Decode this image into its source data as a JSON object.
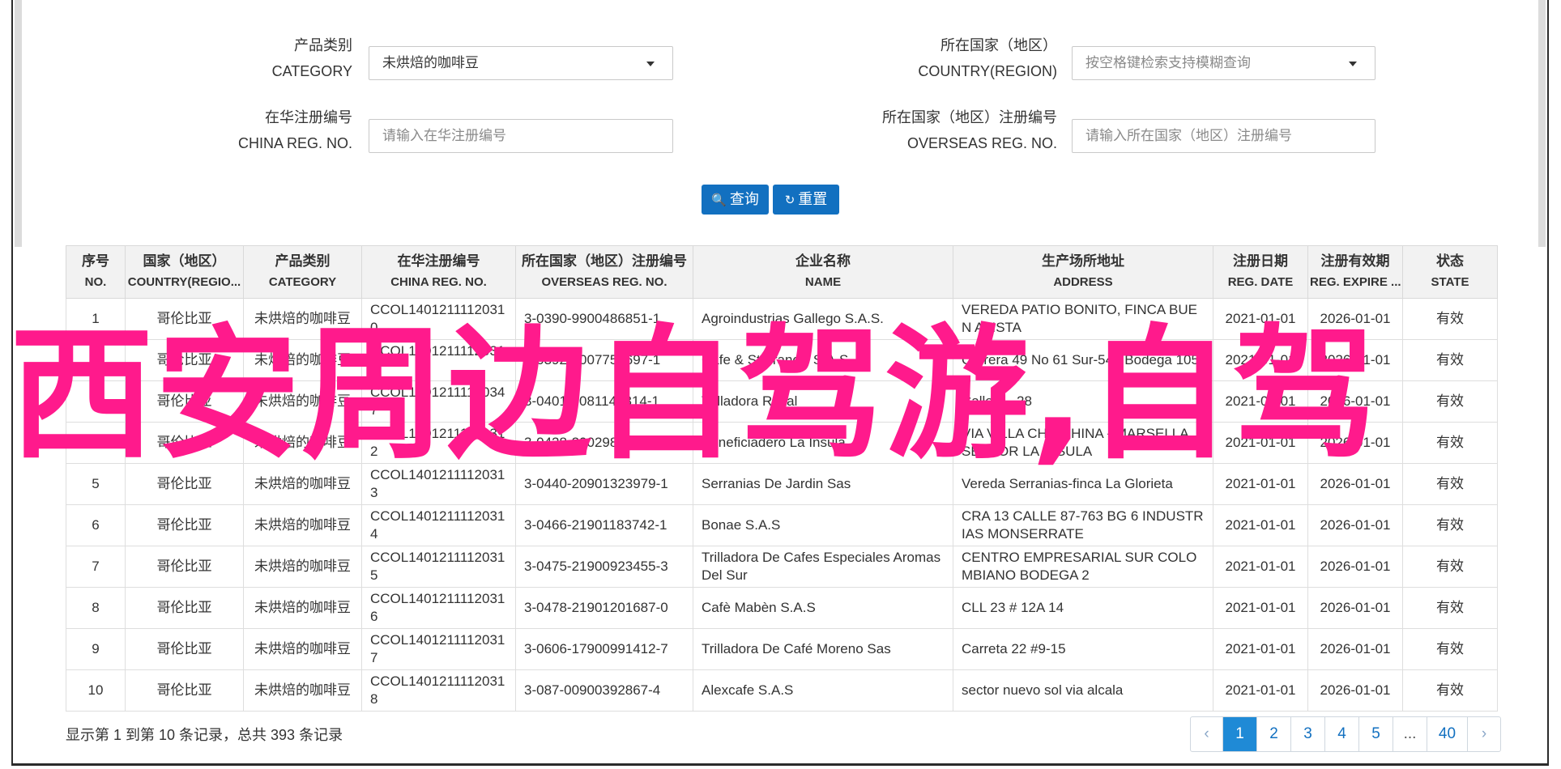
{
  "filters": {
    "category": {
      "label_cn": "产品类别",
      "label_en": "CATEGORY",
      "value": "未烘焙的咖啡豆"
    },
    "country": {
      "label_cn": "所在国家（地区）",
      "label_en": "COUNTRY(REGION)",
      "placeholder": "按空格键检索支持模糊查询"
    },
    "china_reg": {
      "label_cn": "在华注册编号",
      "label_en": "CHINA REG. NO.",
      "placeholder": "请输入在华注册编号"
    },
    "overseas_reg": {
      "label_cn": "所在国家（地区）注册编号",
      "label_en": "OVERSEAS REG. NO.",
      "placeholder": "请输入所在国家（地区）注册编号"
    }
  },
  "buttons": {
    "search": "查询",
    "reset": "重置"
  },
  "table": {
    "headers": [
      {
        "cn": "序号",
        "en": "NO."
      },
      {
        "cn": "国家（地区）",
        "en": "COUNTRY(REGIO..."
      },
      {
        "cn": "产品类别",
        "en": "CATEGORY"
      },
      {
        "cn": "在华注册编号",
        "en": "CHINA REG. NO."
      },
      {
        "cn": "所在国家（地区）注册编号",
        "en": "OVERSEAS REG. NO."
      },
      {
        "cn": "企业名称",
        "en": "NAME"
      },
      {
        "cn": "生产场所地址",
        "en": "ADDRESS"
      },
      {
        "cn": "注册日期",
        "en": "REG. DATE"
      },
      {
        "cn": "注册有效期",
        "en": "REG. EXPIRE ..."
      },
      {
        "cn": "状态",
        "en": "STATE"
      }
    ],
    "rows": [
      [
        "1",
        "哥伦比亚",
        "未烘焙的咖啡豆",
        "CCOL14012111120310",
        "3-0390-9900486851-1",
        "Agroindustrias Gallego S.A.S.",
        "VEREDA PATIO BONITO, FINCA BUEN AVISTA",
        "2021-01-01",
        "2026-01-01",
        "有效"
      ],
      [
        "2",
        "哥伦比亚",
        "未烘焙的咖啡豆",
        "CCOL14012111120311",
        "3-0392-9007758697-1",
        "Cafe & St Francis S.A.S.",
        "Carrera 49 No 61 Sur-540 Bodega 105",
        "2021-01-01",
        "2026-01-01",
        "有效"
      ],
      [
        "3",
        "哥伦比亚",
        "未烘焙的咖啡豆",
        "CCOL14012111120347",
        "3-0401-0081148314-1",
        "Trilladora Royal",
        "Calle 5 - 28",
        "2021-01-01",
        "2026-01-01",
        "有效"
      ],
      [
        "4",
        "哥伦比亚",
        "未烘焙的咖啡豆",
        "CCOL14012111120312",
        "3-0428-2002988649",
        "Beneficiadero La Insula",
        "VIA VILLA CHINCHINA - MARSELLA, SECTOR LA INSULA",
        "2021-01-01",
        "2026-01-01",
        "有效"
      ],
      [
        "5",
        "哥伦比亚",
        "未烘焙的咖啡豆",
        "CCOL14012111120313",
        "3-0440-20901323979-1",
        "Serranias De Jardin Sas",
        "Vereda Serranias-finca La Glorieta",
        "2021-01-01",
        "2026-01-01",
        "有效"
      ],
      [
        "6",
        "哥伦比亚",
        "未烘焙的咖啡豆",
        "CCOL14012111120314",
        "3-0466-21901183742-1",
        "Bonae S.A.S",
        "CRA 13 CALLE 87-763 BG 6 INDUSTRIAS MONSERRATE",
        "2021-01-01",
        "2026-01-01",
        "有效"
      ],
      [
        "7",
        "哥伦比亚",
        "未烘焙的咖啡豆",
        "CCOL14012111120315",
        "3-0475-21900923455-3",
        "Trilladora De Cafes Especiales Aromas Del Sur",
        "CENTRO EMPRESARIAL SUR COLOMBIANO BODEGA 2",
        "2021-01-01",
        "2026-01-01",
        "有效"
      ],
      [
        "8",
        "哥伦比亚",
        "未烘焙的咖啡豆",
        "CCOL14012111120316",
        "3-0478-21901201687-0",
        "Cafè Mabèn S.A.S",
        "CLL 23 # 12A 14",
        "2021-01-01",
        "2026-01-01",
        "有效"
      ],
      [
        "9",
        "哥伦比亚",
        "未烘焙的咖啡豆",
        "CCOL14012111120317",
        "3-0606-17900991412-7",
        "Trilladora De Café Moreno Sas",
        "Carreta 22 #9-15",
        "2021-01-01",
        "2026-01-01",
        "有效"
      ],
      [
        "10",
        "哥伦比亚",
        "未烘焙的咖啡豆",
        "CCOL14012111120318",
        "3-087-00900392867-4",
        "Alexcafe S.A.S",
        "sector nuevo sol via alcala",
        "2021-01-01",
        "2026-01-01",
        "有效"
      ]
    ]
  },
  "watermark": "西安周边自驾游,自驾",
  "footer": {
    "summary": "显示第 1 到第 10 条记录，总共 393 条记录"
  },
  "pagination": {
    "prev": "‹",
    "pages": [
      "1",
      "2",
      "3",
      "4",
      "5",
      "...",
      "40"
    ],
    "next": "›",
    "active": "1"
  },
  "colors": {
    "primary": "#1270c0",
    "watermark": "#ff1a8c"
  }
}
